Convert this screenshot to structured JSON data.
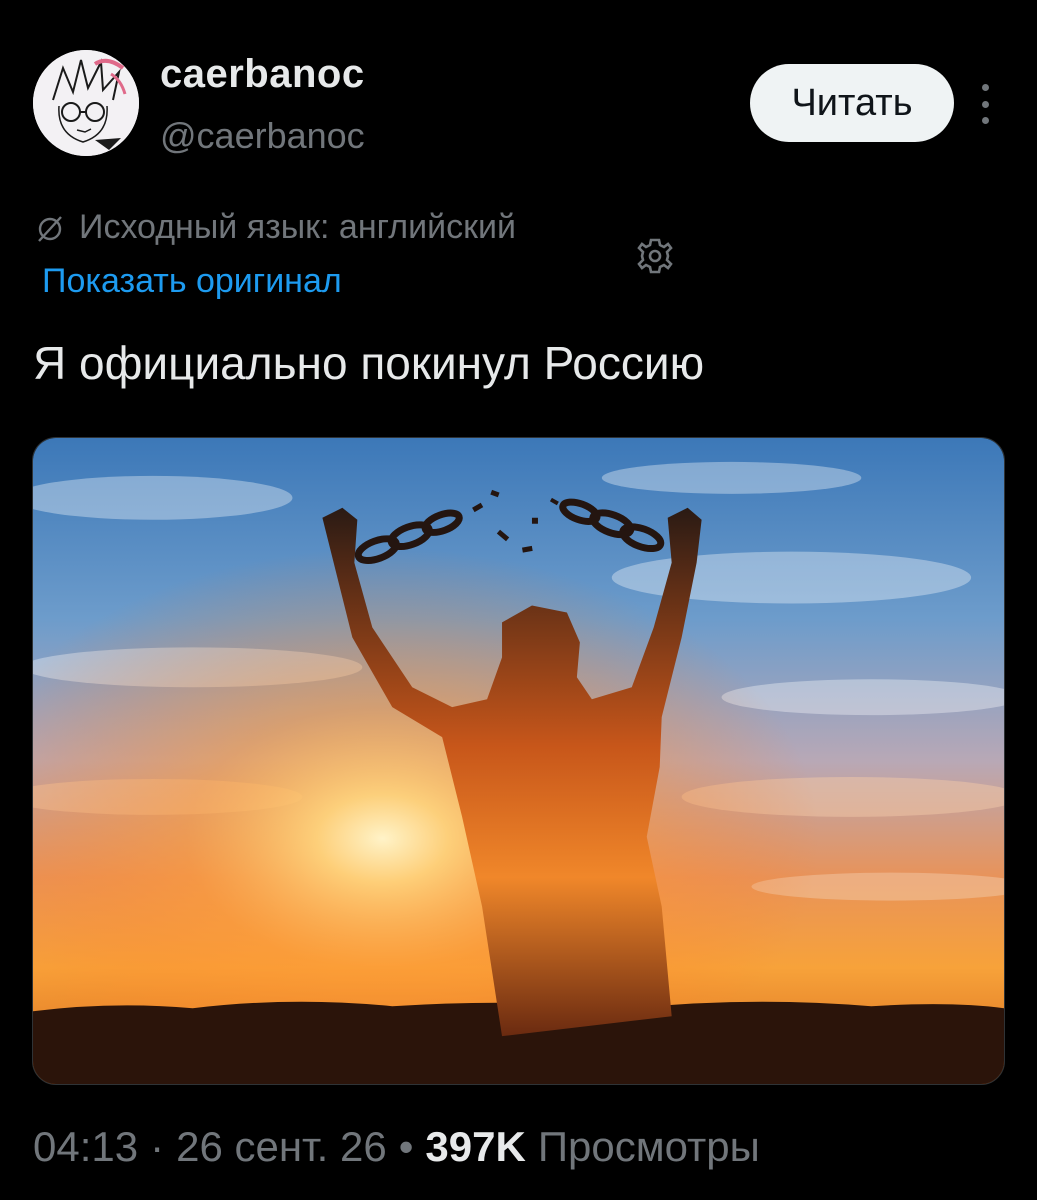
{
  "author": {
    "display_name": "caerbanoc",
    "handle": "@caerbanoc",
    "avatar_icon": "anime-avatar-sketch"
  },
  "actions": {
    "follow_label": "Читать",
    "more_icon": "vertical-ellipsis-icon"
  },
  "translation": {
    "icon": "translate-icon",
    "source_language_label": "Исходный язык: английский",
    "show_original_label": "Показать оригинал",
    "settings_icon": "gear-icon",
    "link_color": "#1d9bf0"
  },
  "post": {
    "text": "Я официально покинул Россию",
    "media_description_icon": "photo-silhouette-breaking-chains"
  },
  "meta": {
    "time": "04:13",
    "date": "26 сент. 26",
    "views_count": "397K",
    "views_label": "Просмотры",
    "separator": "·",
    "separator_bold": "•"
  },
  "colors": {
    "background": "#000000",
    "primary_text": "#e7e9ea",
    "secondary_text": "#71767b",
    "button_bg": "#eff3f4"
  }
}
